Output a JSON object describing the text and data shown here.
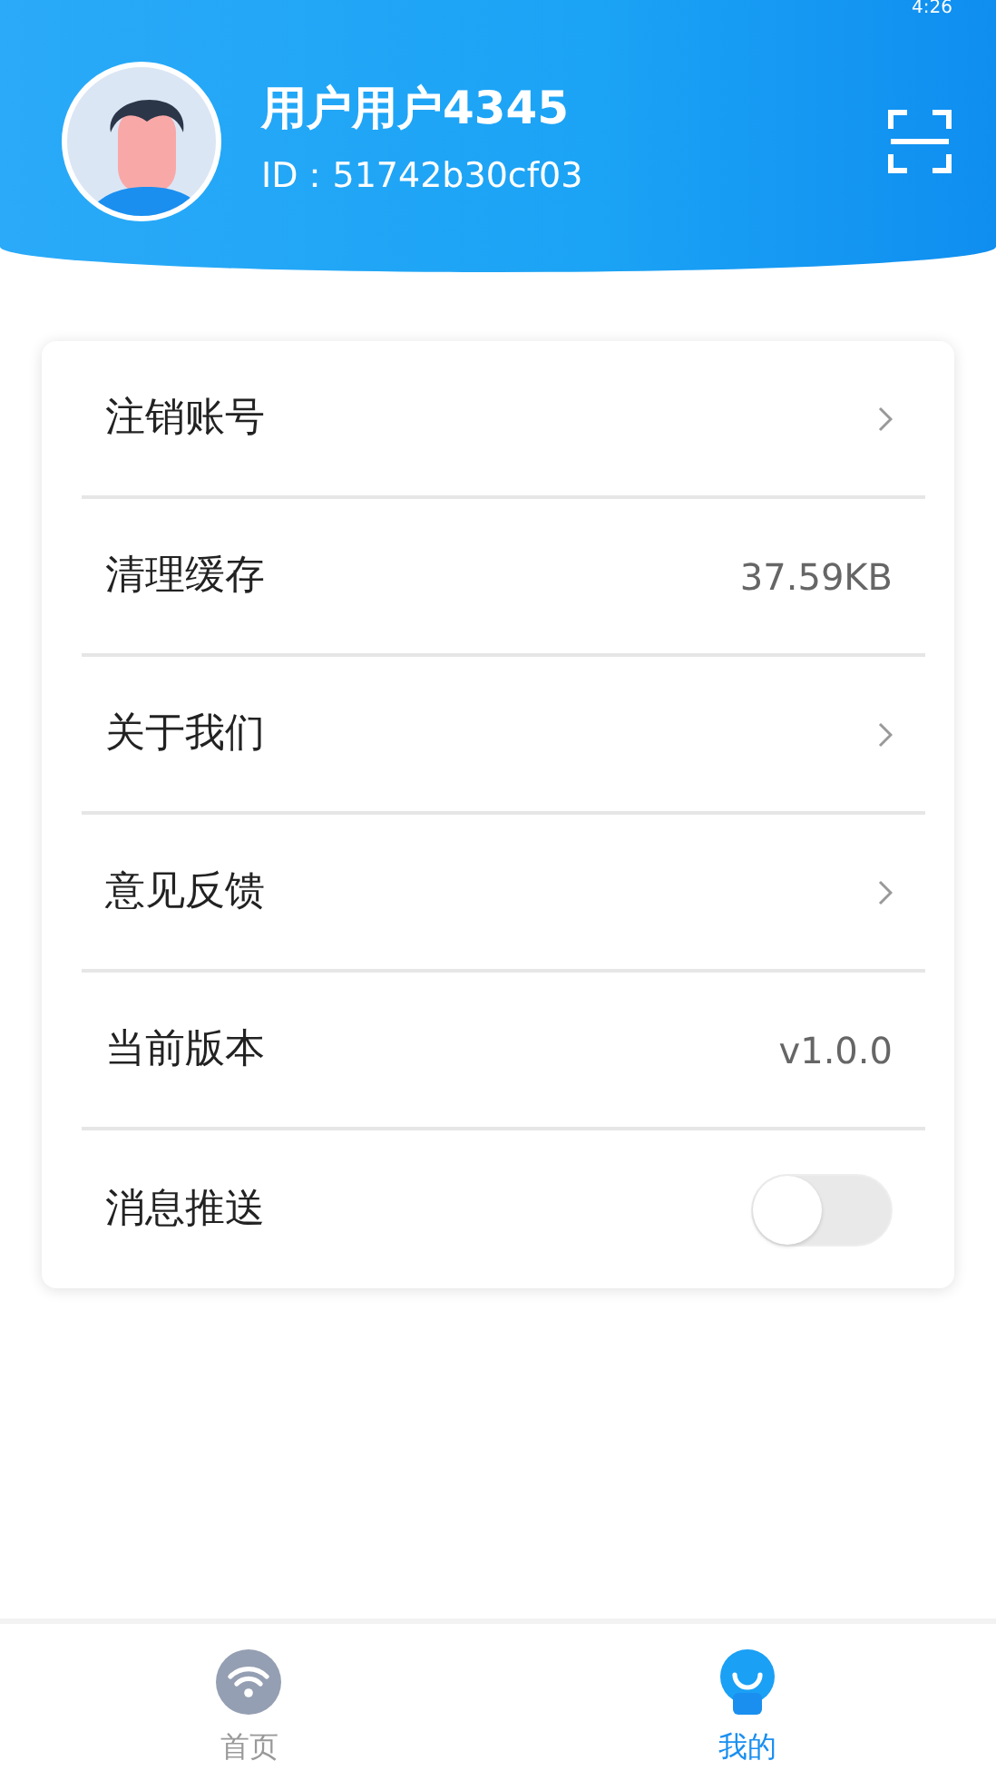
{
  "status_bar": {
    "time": "4:26"
  },
  "profile": {
    "name": "用户用户4345",
    "id": "ID：51742b30cf03"
  },
  "settings": [
    {
      "kind": "link",
      "label": "注销账号"
    },
    {
      "kind": "value",
      "label": "清理缓存",
      "value": "37.59KB"
    },
    {
      "kind": "link",
      "label": "关于我们"
    },
    {
      "kind": "link",
      "label": "意见反馈"
    },
    {
      "kind": "value",
      "label": "当前版本",
      "value": "v1.0.0"
    },
    {
      "kind": "toggle",
      "label": "消息推送",
      "on": false
    }
  ],
  "bottom_nav": [
    {
      "label": "首页",
      "selected": false
    },
    {
      "label": "我的",
      "selected": true
    }
  ]
}
